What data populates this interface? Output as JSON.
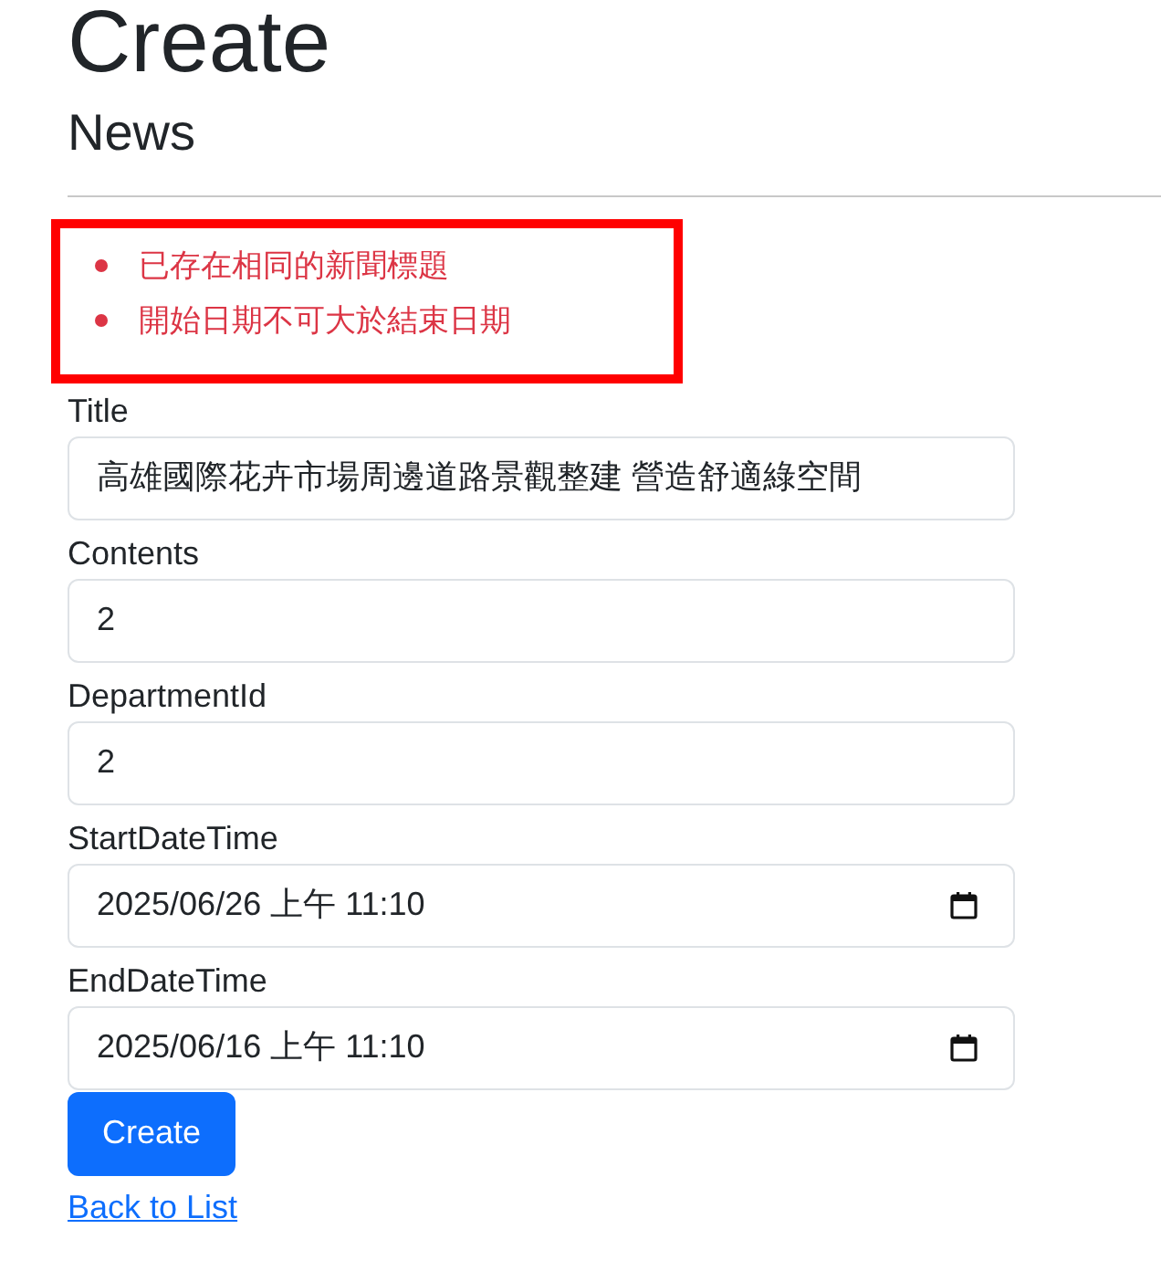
{
  "heading": "Create",
  "subheading": "News",
  "errors": {
    "highlighted": true,
    "items": [
      "已存在相同的新聞標題",
      "開始日期不可大於結束日期"
    ]
  },
  "fields": [
    {
      "label": "Title",
      "kind": "text",
      "value": "高雄國際花卉市場周邊道路景觀整建 營造舒適綠空間"
    },
    {
      "label": "Contents",
      "kind": "text",
      "value": "2"
    },
    {
      "label": "DepartmentId",
      "kind": "text",
      "value": "2"
    },
    {
      "label": "StartDateTime",
      "kind": "datetime",
      "value": "2025/06/26 上午 11:10"
    },
    {
      "label": "EndDateTime",
      "kind": "datetime",
      "value": "2025/06/16 上午 11:10"
    }
  ],
  "submit_button": "Create",
  "back_link": "Back to List"
}
